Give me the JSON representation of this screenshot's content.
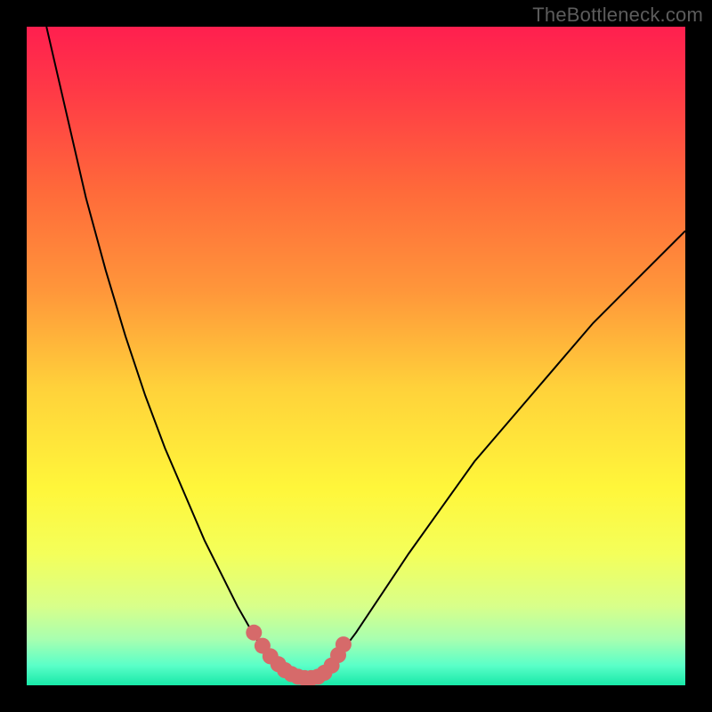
{
  "watermark": "TheBottleneck.com",
  "colors": {
    "frame": "#000000",
    "curve_stroke": "#000000",
    "marker_fill": "#d66a6a",
    "gradient_stops": [
      {
        "offset": 0.0,
        "color": "#ff1f4f"
      },
      {
        "offset": 0.1,
        "color": "#ff3a46"
      },
      {
        "offset": 0.25,
        "color": "#ff6a3a"
      },
      {
        "offset": 0.4,
        "color": "#ff963a"
      },
      {
        "offset": 0.55,
        "color": "#ffd23a"
      },
      {
        "offset": 0.7,
        "color": "#fff63a"
      },
      {
        "offset": 0.8,
        "color": "#f4ff5a"
      },
      {
        "offset": 0.88,
        "color": "#d8ff8a"
      },
      {
        "offset": 0.93,
        "color": "#a8ffb0"
      },
      {
        "offset": 0.97,
        "color": "#5affc8"
      },
      {
        "offset": 1.0,
        "color": "#18e9a8"
      }
    ]
  },
  "chart_data": {
    "type": "line",
    "title": "",
    "xlabel": "",
    "ylabel": "",
    "xlim": [
      0,
      100
    ],
    "ylim": [
      0,
      100
    ],
    "grid": false,
    "legend": false,
    "series": [
      {
        "name": "left-curve",
        "x": [
          3,
          6,
          9,
          12,
          15,
          18,
          21,
          24,
          27,
          30,
          32,
          34,
          35.5,
          37,
          38.5,
          40
        ],
        "y": [
          100,
          87,
          74,
          63,
          53,
          44,
          36,
          29,
          22,
          16,
          12,
          8.5,
          6,
          4,
          2.5,
          1.5
        ]
      },
      {
        "name": "valley-floor",
        "x": [
          40,
          41,
          42,
          43,
          44,
          45
        ],
        "y": [
          1.5,
          1.2,
          1.0,
          1.0,
          1.2,
          1.8
        ]
      },
      {
        "name": "right-curve",
        "x": [
          45,
          47,
          50,
          54,
          58,
          63,
          68,
          74,
          80,
          86,
          92,
          100
        ],
        "y": [
          1.8,
          4,
          8,
          14,
          20,
          27,
          34,
          41,
          48,
          55,
          61,
          69
        ]
      }
    ],
    "markers": {
      "name": "valley-markers",
      "x": [
        34.5,
        35.8,
        37.0,
        38.2,
        39.2,
        40.2,
        41.2,
        42.2,
        43.2,
        44.2,
        45.2,
        46.3,
        47.3,
        48.1
      ],
      "y": [
        8.0,
        6.0,
        4.4,
        3.2,
        2.3,
        1.7,
        1.3,
        1.1,
        1.1,
        1.3,
        1.9,
        3.0,
        4.6,
        6.2
      ],
      "radius": 9
    }
  }
}
